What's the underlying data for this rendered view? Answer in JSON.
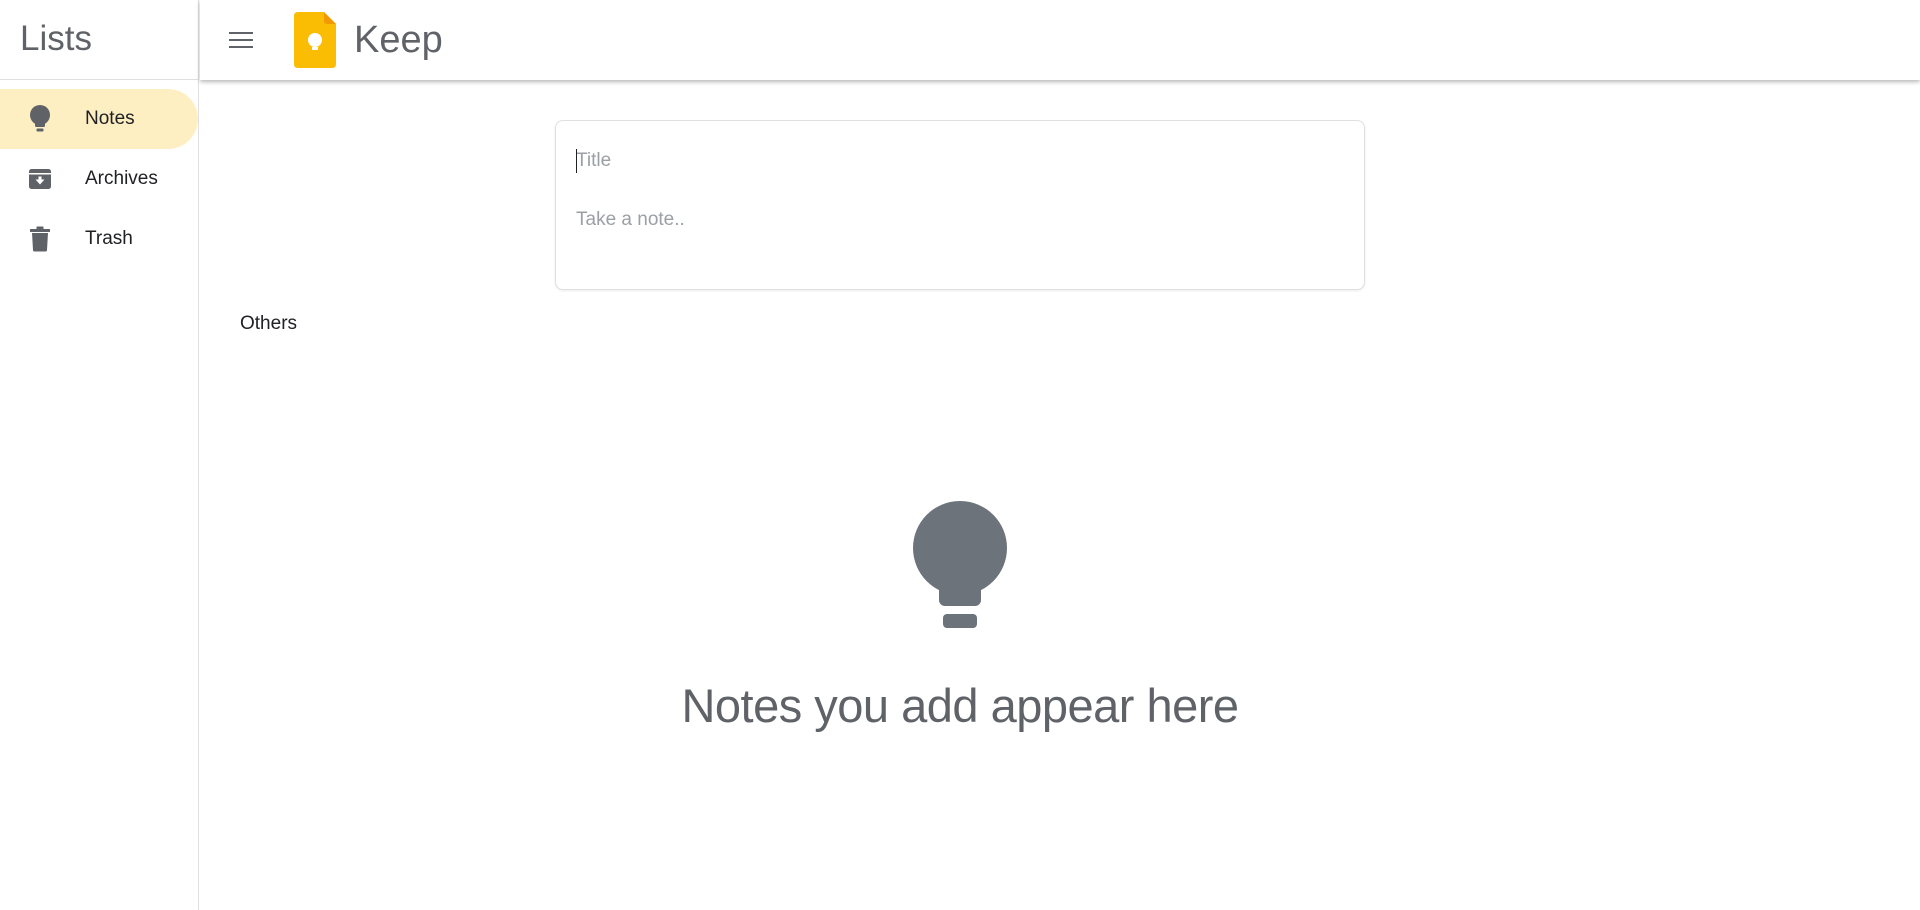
{
  "sidebar": {
    "title": "Lists",
    "items": [
      {
        "label": "Notes",
        "icon": "lightbulb-icon",
        "active": true
      },
      {
        "label": "Archives",
        "icon": "archive-icon",
        "active": false
      },
      {
        "label": "Trash",
        "icon": "trash-icon",
        "active": false
      }
    ]
  },
  "header": {
    "menu_icon": "hamburger-menu-icon",
    "logo": "keep-logo",
    "title": "Keep"
  },
  "composer": {
    "title_placeholder": "Title",
    "body_placeholder": "Take a note.."
  },
  "section": {
    "label": "Others"
  },
  "empty_state": {
    "icon": "lightbulb-icon",
    "message": "Notes you add appear here"
  },
  "colors": {
    "accent": "#feefc3",
    "logo_yellow": "#fbbc04",
    "icon_gray": "#5f6368",
    "empty_icon_gray": "#6d737a"
  }
}
